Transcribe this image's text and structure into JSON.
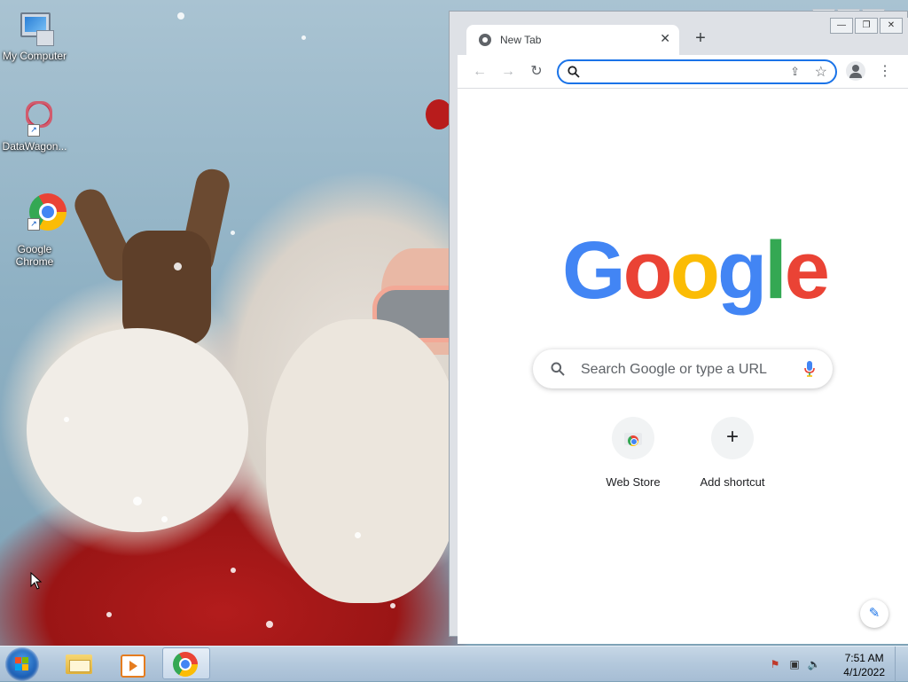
{
  "desktop": {
    "icons": [
      {
        "label": "My Computer",
        "icon": "computer-icon"
      },
      {
        "label": "DataWagon...",
        "icon": "datawagon-icon"
      },
      {
        "label": "Google Chrome",
        "icon": "chrome-icon"
      }
    ]
  },
  "browser": {
    "tab_title": "New Tab",
    "omnibox_value": "",
    "page": {
      "logo": [
        "G",
        "o",
        "o",
        "g",
        "l",
        "e"
      ],
      "search_placeholder": "Search Google or type a URL",
      "shortcuts": [
        {
          "label": "Web Store"
        },
        {
          "label": "Add shortcut"
        }
      ]
    }
  },
  "taskbar": {
    "time": "7:51 AM",
    "date": "4/1/2022"
  },
  "colors": {
    "blue": "#4285f4",
    "red": "#ea4335",
    "yellow": "#fbbc05",
    "green": "#34a853",
    "accent": "#1a73e8"
  }
}
